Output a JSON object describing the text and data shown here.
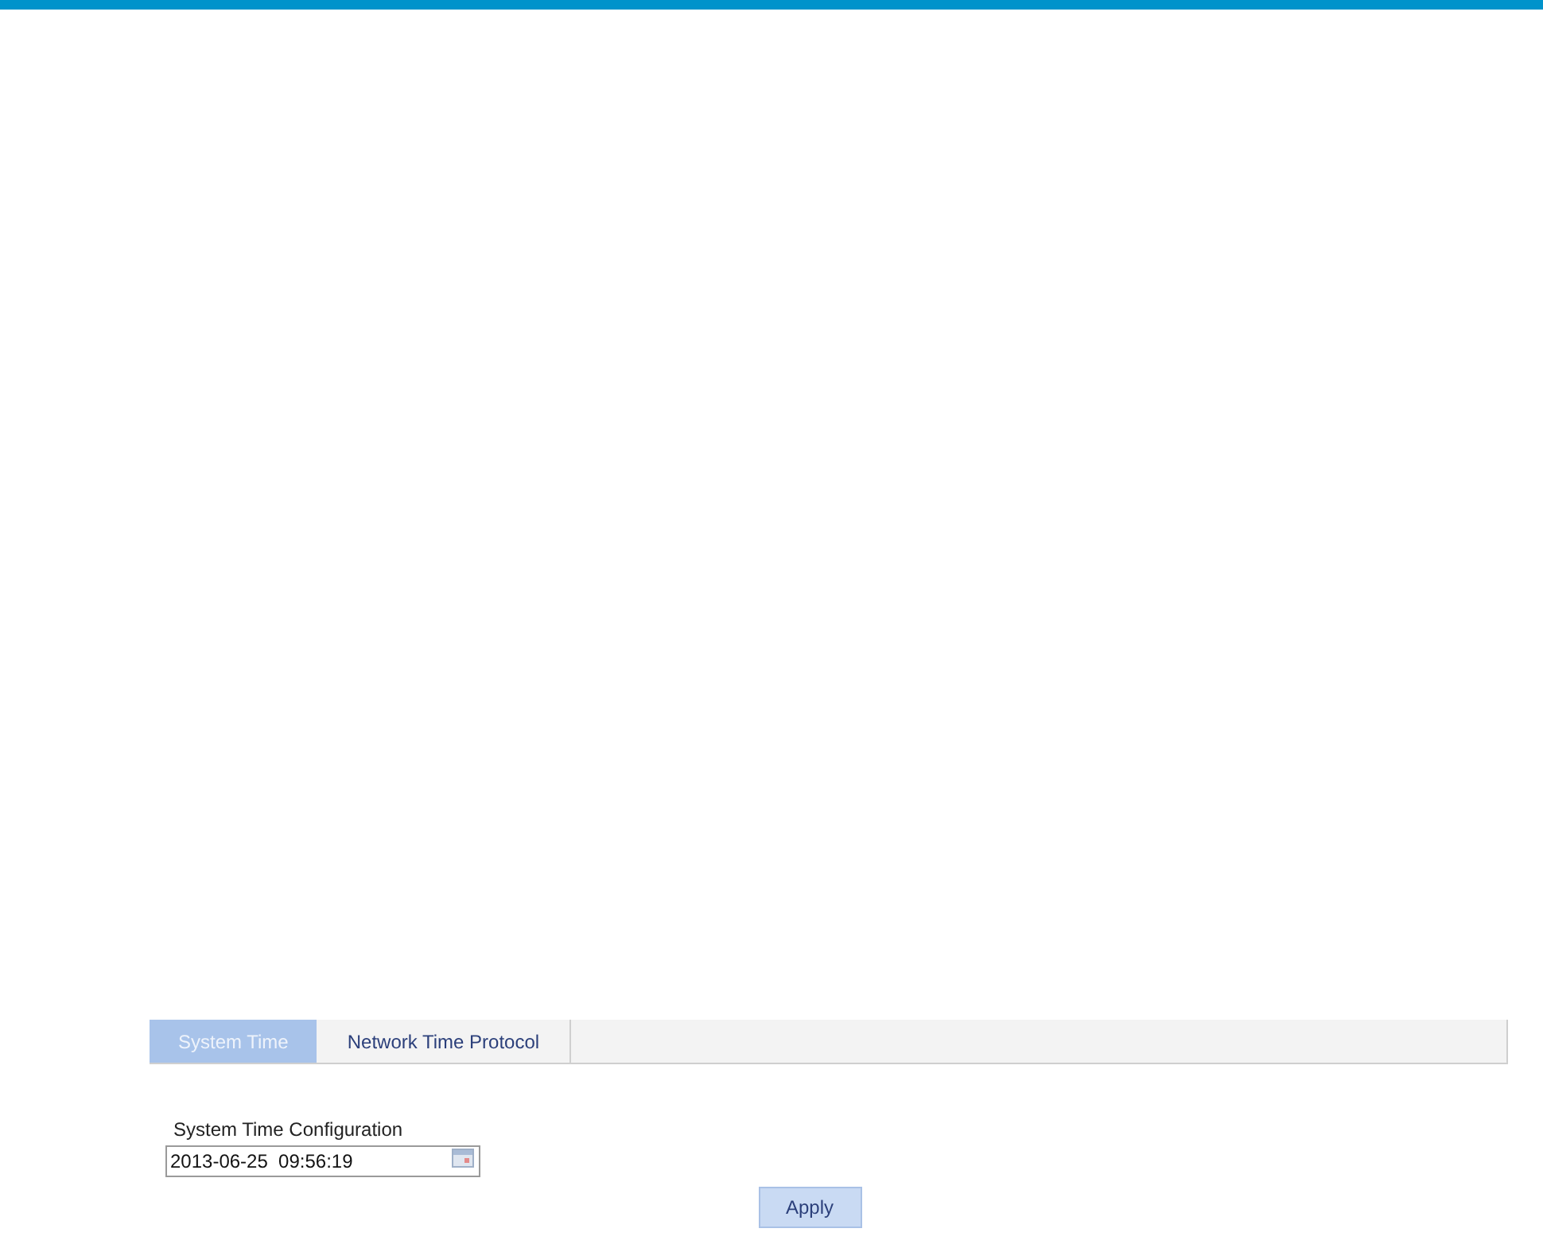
{
  "tabs": [
    {
      "label": "System Time",
      "selected": true
    },
    {
      "label": "Network Time Protocol",
      "selected": false
    }
  ],
  "section_title": "System Time Configuration",
  "datetime_field": {
    "value": "2013-06-25  09:56:19"
  },
  "buttons": [
    "Apply"
  ]
}
